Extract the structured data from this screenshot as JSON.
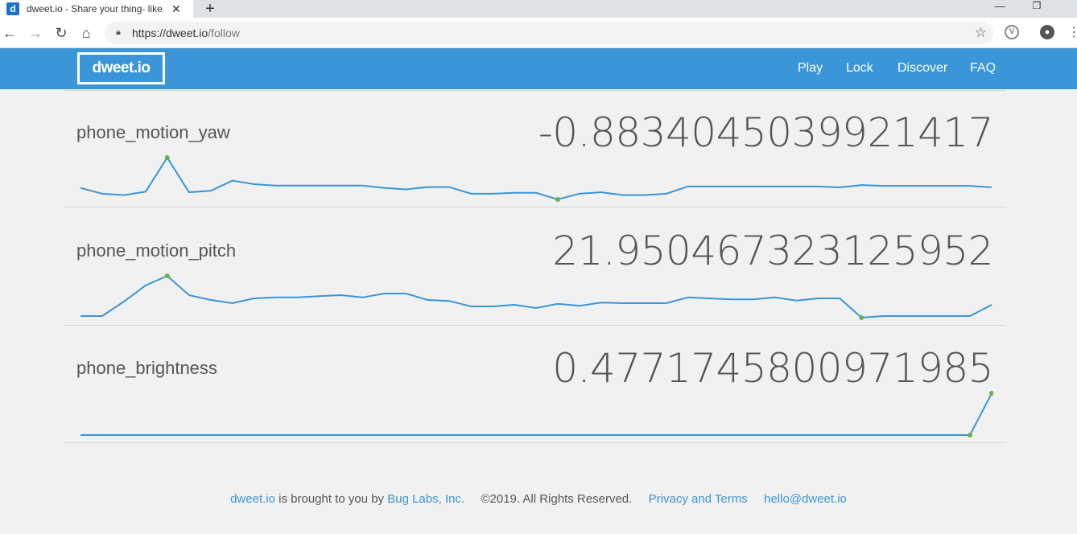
{
  "browser": {
    "tab_title": "dweet.io - Share your thing- like",
    "tab_favicon": "d",
    "url_host": "https://dweet.io",
    "url_path": "/follow"
  },
  "header": {
    "logo": "dweet.io",
    "nav": [
      "Play",
      "Lock",
      "Discover",
      "FAQ"
    ]
  },
  "rows": [
    {
      "label": "phone_motion_yaw",
      "value": "-0.8834045039921417",
      "spark": [
        -0.05,
        -0.25,
        -0.3,
        -0.18,
        1.0,
        -0.2,
        -0.15,
        0.2,
        0.08,
        0.03,
        0.03,
        0.03,
        0.03,
        0.03,
        -0.05,
        -0.1,
        -0.02,
        -0.02,
        -0.25,
        -0.25,
        -0.22,
        -0.22,
        -0.45,
        -0.25,
        -0.2,
        -0.3,
        -0.3,
        -0.25,
        0.0,
        0.0,
        0.0,
        0.0,
        0.0,
        0.0,
        0.0,
        -0.03,
        0.05,
        0.02,
        0.02,
        0.02,
        0.02,
        0.02,
        -0.03
      ]
    },
    {
      "label": "phone_motion_pitch",
      "value": "21.950467323125952",
      "spark": [
        -0.2,
        -0.2,
        0.25,
        0.75,
        1.05,
        0.45,
        0.3,
        0.2,
        0.35,
        0.38,
        0.38,
        0.42,
        0.45,
        0.38,
        0.5,
        0.5,
        0.3,
        0.27,
        0.1,
        0.1,
        0.15,
        0.05,
        0.18,
        0.12,
        0.22,
        0.2,
        0.2,
        0.2,
        0.38,
        0.35,
        0.32,
        0.32,
        0.38,
        0.28,
        0.35,
        0.35,
        -0.25,
        -0.2,
        -0.2,
        -0.2,
        -0.2,
        -0.2,
        0.15
      ]
    },
    {
      "label": "phone_brightness",
      "value": "0.4771745800971985",
      "spark": [
        0,
        0,
        0,
        0,
        0,
        0,
        0,
        0,
        0,
        0,
        0,
        0,
        0,
        0,
        0,
        0,
        0,
        0,
        0,
        0,
        0,
        0,
        0,
        0,
        0,
        0,
        0,
        0,
        0,
        0,
        0,
        0,
        0,
        0,
        0,
        0,
        0,
        0,
        0,
        0,
        0,
        0,
        0.47
      ]
    }
  ],
  "footer": {
    "link1": "dweet.io",
    "text1": "is brought to you by",
    "link2": "Bug Labs, Inc.",
    "copyright": "©2019. All Rights Reserved.",
    "link3": "Privacy and Terms",
    "link4": "hello@dweet.io"
  },
  "colors": {
    "accent": "#3a95d9",
    "spark_line": "#3a95d9",
    "spark_dot": "#6ab04c"
  }
}
